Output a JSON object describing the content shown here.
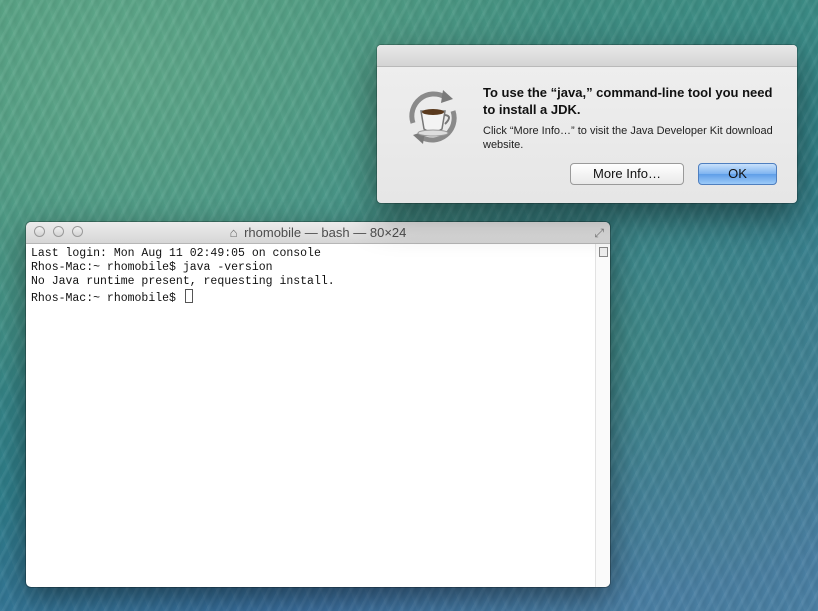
{
  "terminal": {
    "title_main": "rhomobile",
    "title_sep1": "—",
    "title_process": "bash",
    "title_sep2": "—",
    "title_size": "80×24",
    "lines": [
      "Last login: Mon Aug 11 02:49:05 on console",
      "Rhos-Mac:~ rhomobile$ java -version",
      "No Java runtime present, requesting install.",
      "Rhos-Mac:~ rhomobile$ "
    ]
  },
  "dialog": {
    "title": "To use the “java,” command-line tool you need to install a JDK.",
    "body": "Click “More Info…” to visit the Java Developer Kit download website.",
    "more_info_label": "More Info…",
    "ok_label": "OK"
  },
  "icons": {
    "home": "home-icon",
    "resize": "fullscreen-icon",
    "java": "java-cup-icon"
  },
  "colors": {
    "ok_button": "#6fa9ee",
    "terminal_bg": "#ffffff"
  }
}
